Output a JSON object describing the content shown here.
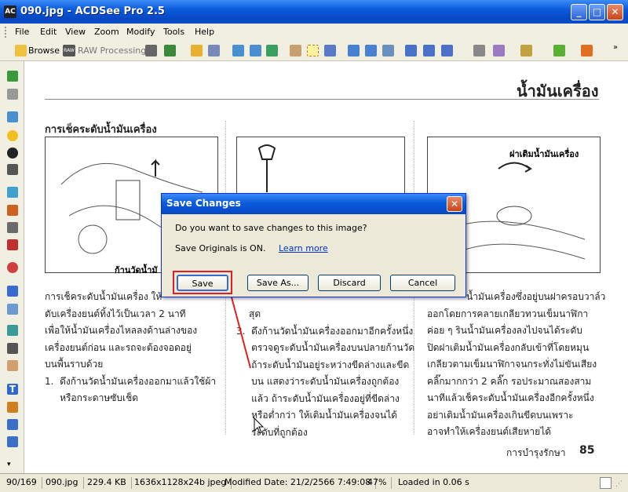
{
  "window": {
    "title": "090.jpg - ACDSee Pro 2.5",
    "app_icon_label": "AC"
  },
  "menu": [
    "File",
    "Edit",
    "View",
    "Zoom",
    "Modify",
    "Tools",
    "Help"
  ],
  "toolbar": {
    "browse_label": "Browse",
    "raw_label": "RAW Processing",
    "raw_badge": "RAW"
  },
  "document": {
    "heading": "น้ำมันเครื่อง",
    "section_title": "การเช็คระดับน้ำมันเครื่อง",
    "callout_left": "ก้านวัดน้ำมั",
    "callout_right": "ฝาเติมน้ำมันเครื่อง",
    "col1": [
      "การเช็คระดับน้ำมันเครื่อง ให้",
      "ดับเครื่องยนต์ทิ้งไว้เป็นเวลา 2 นาที",
      "เพื่อให้น้ำมันเครื่องไหลลงด้านล่างของ",
      "เครื่องยนต์ก่อน และรถจะต้องจอดอยู่",
      "บนพื้นราบด้วย",
      "1.  ดึงก้านวัดน้ำมันเครื่องออกมาแล้วใช้ผ้า",
      "     หรือกระดาษซับเช็ด"
    ],
    "col2": [
      "สุด",
      "3.  ดึงก้านวัดน้ำมันเครื่องออกมาอีกครั้งหนึ่ง",
      "     ตรวจดูระดับน้ำมันเครื่องบนปลายก้านวัด",
      "     ถ้าระดับน้ำมันอยู่ระหว่างขีดล่างและขีด",
      "     บน แสดงว่าระดับน้ำมันเครื่องถูกต้อง",
      "     แล้ว ถ้าระดับน้ำมันเครื่องอยู่ที่ขีดล่าง",
      "     หรือต่ำกว่า ให้เติมน้ำมันเครื่องจนได้",
      "     ระดับที่ถูกต้อง"
    ],
    "col3": [
      "น้ำมันเครื่องซึ่งอยู่บนฝาครอบวาล์ว",
      "ออกโดยการคลายเกลียวทวนเข็มนาฬิกา",
      "ค่อย ๆ รินน้ำมันเครื่องลงไปจนได้ระดับ",
      "ปิดฝาเติมน้ำมันเครื่องกลับเข้าที่โดยหมุน",
      "เกลียวตามเข็มนาฬิกาจนกระทั่งไม่ขันเสียง",
      "คลิ๊กมากกว่า 2 คลิ๊ก รอประมาณสองสาม",
      "นาทีแล้วเช็คระดับน้ำมันเครื่องอีกครั้งหนึ่ง",
      "อย่าเติมน้ำมันเครื่องเกินขีดบนเพราะ",
      "อาจทำให้เครื่องยนต์เสียหายได้"
    ],
    "footer_text": "การบำรุงรักษา",
    "page_number": "85"
  },
  "dialog": {
    "title": "Save Changes",
    "question": "Do you want to save changes to this image?",
    "info": "Save Originals is ON.",
    "link": "Learn more",
    "buttons": {
      "save": "Save",
      "save_as": "Save As...",
      "discard": "Discard",
      "cancel": "Cancel"
    },
    "highlight_color": "#e02020"
  },
  "status": {
    "index": "90/169",
    "filename": "090.jpg",
    "size": "229.4 KB",
    "dimensions": "1636x1128x24b jpeg",
    "modified": "Modified Date: 21/2/2566 7:49:08",
    "zoom": "47%",
    "load_time": "Loaded in 0.06 s"
  },
  "colors": {
    "accent": "#0a5bdc",
    "close": "#c9441c"
  }
}
